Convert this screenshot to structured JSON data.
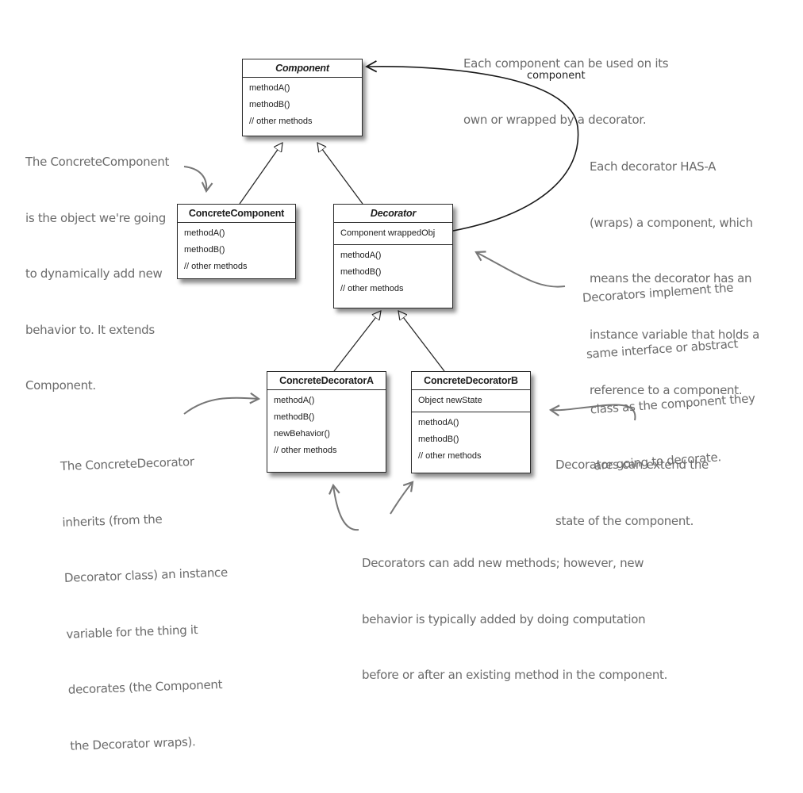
{
  "classes": {
    "component": {
      "name": "Component",
      "abstract": true,
      "fields": [],
      "methods": [
        "methodA()",
        "methodB()",
        "// other methods"
      ]
    },
    "concrete_component": {
      "name": "ConcreteComponent",
      "abstract": false,
      "fields": [],
      "methods": [
        "methodA()",
        "methodB()",
        "// other methods"
      ]
    },
    "decorator": {
      "name": "Decorator",
      "abstract": true,
      "fields": [
        "Component wrappedObj"
      ],
      "methods": [
        "methodA()",
        "methodB()",
        "// other methods"
      ]
    },
    "concrete_decorator_a": {
      "name": "ConcreteDecoratorA",
      "abstract": false,
      "fields": [],
      "methods": [
        "methodA()",
        "methodB()",
        "newBehavior()",
        "// other methods"
      ]
    },
    "concrete_decorator_b": {
      "name": "ConcreteDecoratorB",
      "abstract": false,
      "fields": [
        "Object newState"
      ],
      "methods": [
        "methodA()",
        "methodB()",
        "// other methods"
      ]
    }
  },
  "relationships": [
    {
      "type": "inheritance",
      "from": "ConcreteComponent",
      "to": "Component"
    },
    {
      "type": "inheritance",
      "from": "Decorator",
      "to": "Component"
    },
    {
      "type": "inheritance",
      "from": "ConcreteDecoratorA",
      "to": "Decorator"
    },
    {
      "type": "inheritance",
      "from": "ConcreteDecoratorB",
      "to": "Decorator"
    },
    {
      "type": "association",
      "from": "Decorator",
      "to": "Component",
      "label": "component"
    }
  ],
  "association_label": "component",
  "notes": {
    "each_component": [
      "Each component can be used on its",
      "own or wrapped by a decorator."
    ],
    "concrete_component": [
      "The ConcreteComponent",
      "is the object we're going",
      "to dynamically add new",
      "behavior to. It extends",
      "Component."
    ],
    "has_a": [
      "Each decorator HAS-A",
      "(wraps) a component, which",
      "means the decorator has an",
      "instance variable that holds a",
      "reference to a component."
    ],
    "implement": [
      "Decorators implement the",
      "same interface or abstract",
      "class as the component they",
      "are going to decorate."
    ],
    "extend_state": [
      "Decorators can extend the",
      "state of the component."
    ],
    "concrete_decorator": [
      "The ConcreteDecorator",
      "inherits (from the",
      "Decorator class) an instance",
      "variable for the thing it",
      "decorates (the Component",
      "the Decorator wraps)."
    ],
    "new_methods": [
      "Decorators can add new methods; however, new",
      "behavior is typically added by doing computation",
      "before or after an existing method in the component."
    ]
  },
  "colors": {
    "note_text": "#6b6b6b",
    "uml_line": "#2a2a2a",
    "background": "#ffffff"
  }
}
